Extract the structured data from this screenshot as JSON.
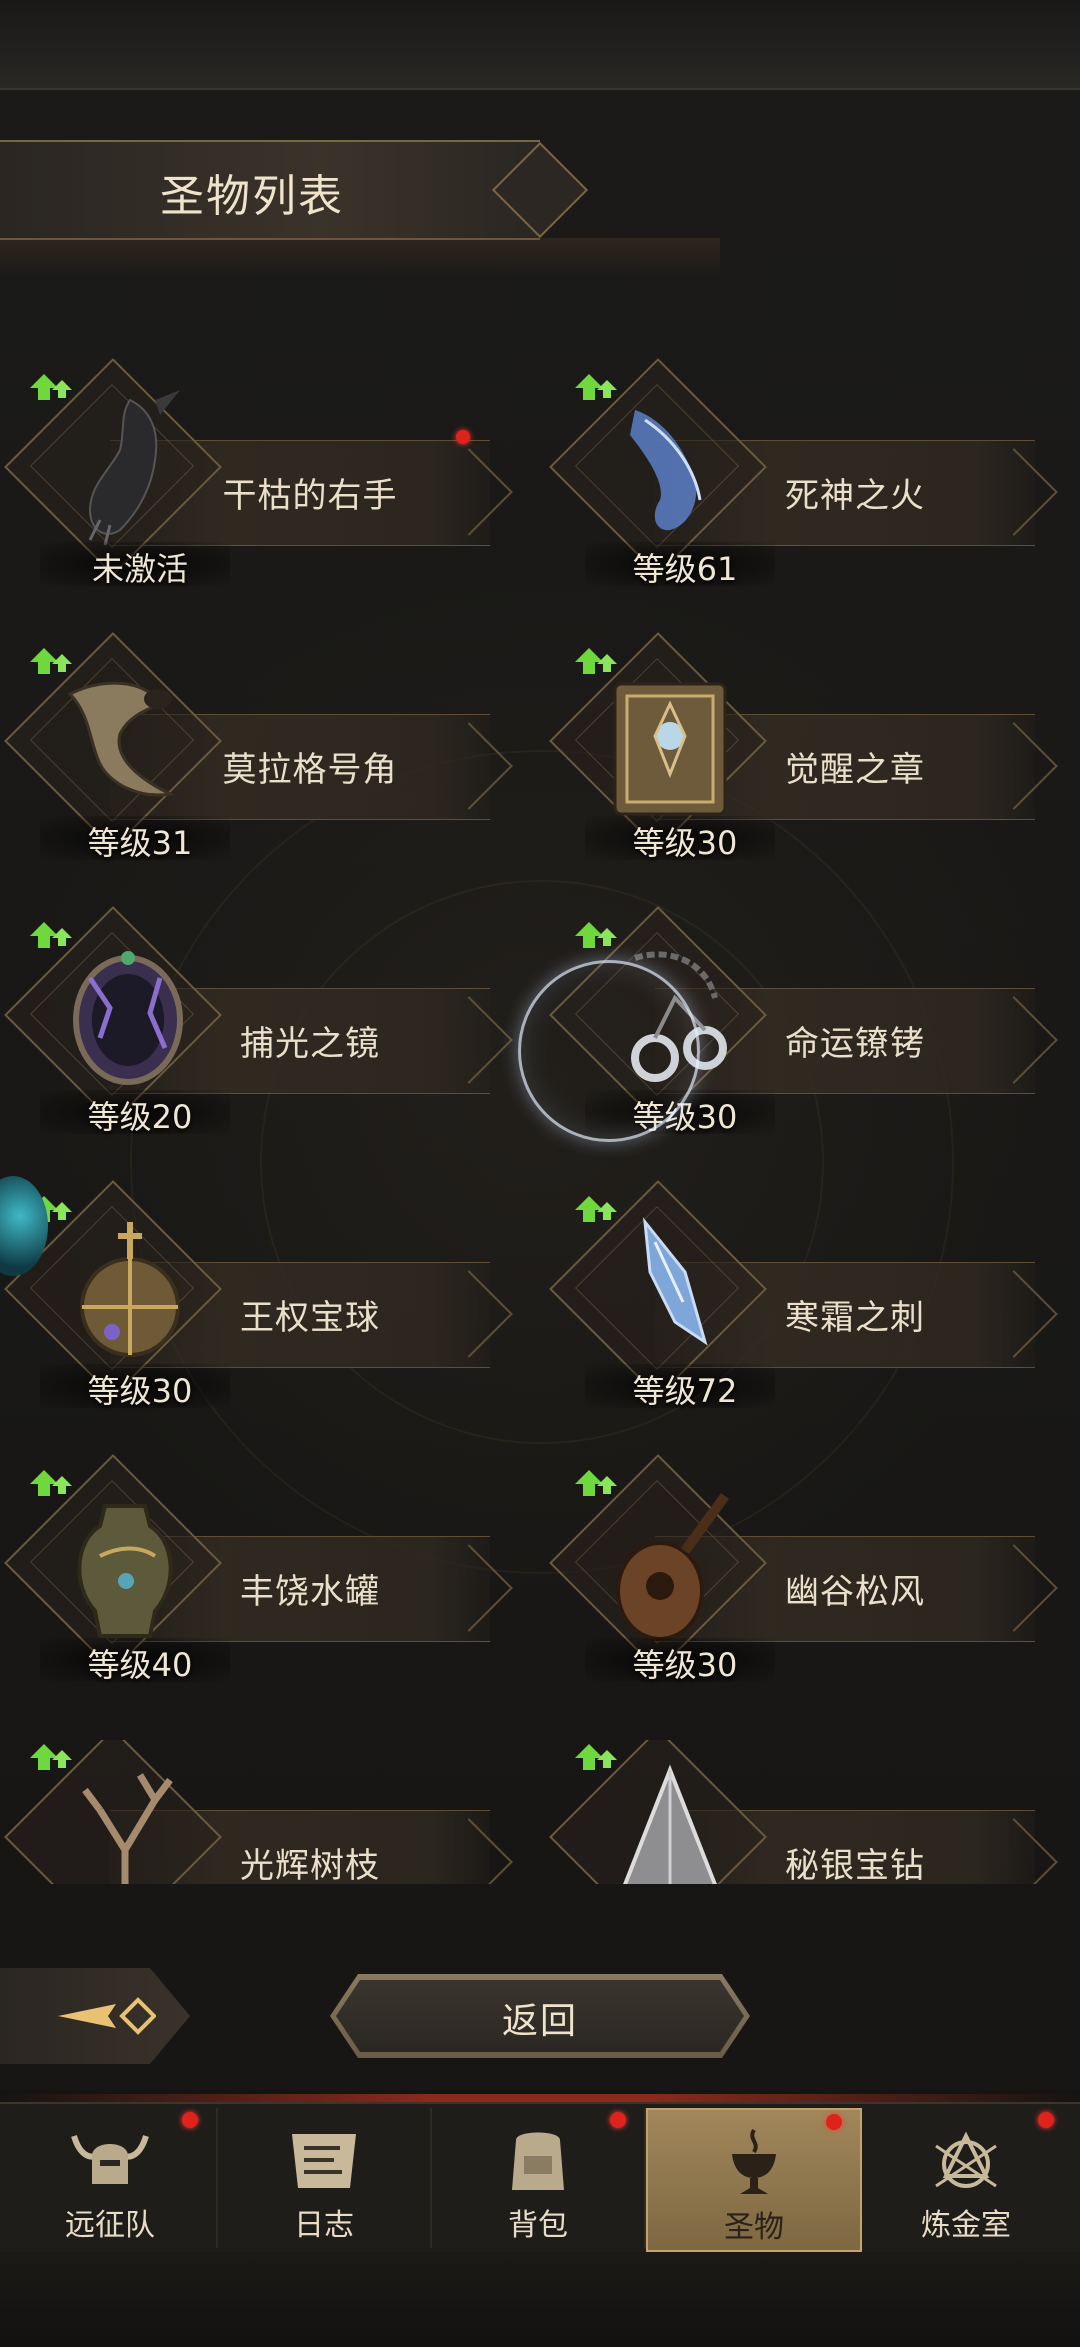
{
  "header": {
    "title": "圣物列表"
  },
  "relics": [
    {
      "name": "干枯的右手",
      "level": "未激活",
      "has_dot": true
    },
    {
      "name": "死神之火",
      "level": "等级61",
      "has_dot": false
    },
    {
      "name": "莫拉格号角",
      "level": "等级31",
      "has_dot": false
    },
    {
      "name": "觉醒之章",
      "level": "等级30",
      "has_dot": false
    },
    {
      "name": "捕光之镜",
      "level": "等级20",
      "has_dot": false
    },
    {
      "name": "命运镣铐",
      "level": "等级30",
      "has_dot": false
    },
    {
      "name": "王权宝球",
      "level": "等级30",
      "has_dot": false
    },
    {
      "name": "寒霜之刺",
      "level": "等级72",
      "has_dot": false
    },
    {
      "name": "丰饶水罐",
      "level": "等级40",
      "has_dot": false
    },
    {
      "name": "幽谷松风",
      "level": "等级30",
      "has_dot": false
    },
    {
      "name": "光辉树枝",
      "level": "",
      "has_dot": false
    },
    {
      "name": "秘银宝钻",
      "level": "",
      "has_dot": false
    }
  ],
  "return_button": {
    "label": "返回"
  },
  "nav": {
    "items": [
      {
        "label": "远征队",
        "icon": "horned-helmet-icon",
        "has_dot": true,
        "active": false
      },
      {
        "label": "日志",
        "icon": "scroll-icon",
        "has_dot": false,
        "active": false
      },
      {
        "label": "背包",
        "icon": "backpack-icon",
        "has_dot": true,
        "active": false
      },
      {
        "label": "圣物",
        "icon": "chalice-icon",
        "has_dot": true,
        "active": true
      },
      {
        "label": "炼金室",
        "icon": "alchemy-icon",
        "has_dot": true,
        "active": false
      }
    ]
  },
  "colors": {
    "accent_gold": "#c2a46d",
    "badge_red": "#e0221c",
    "upgrade_green": "#6fd83c"
  }
}
